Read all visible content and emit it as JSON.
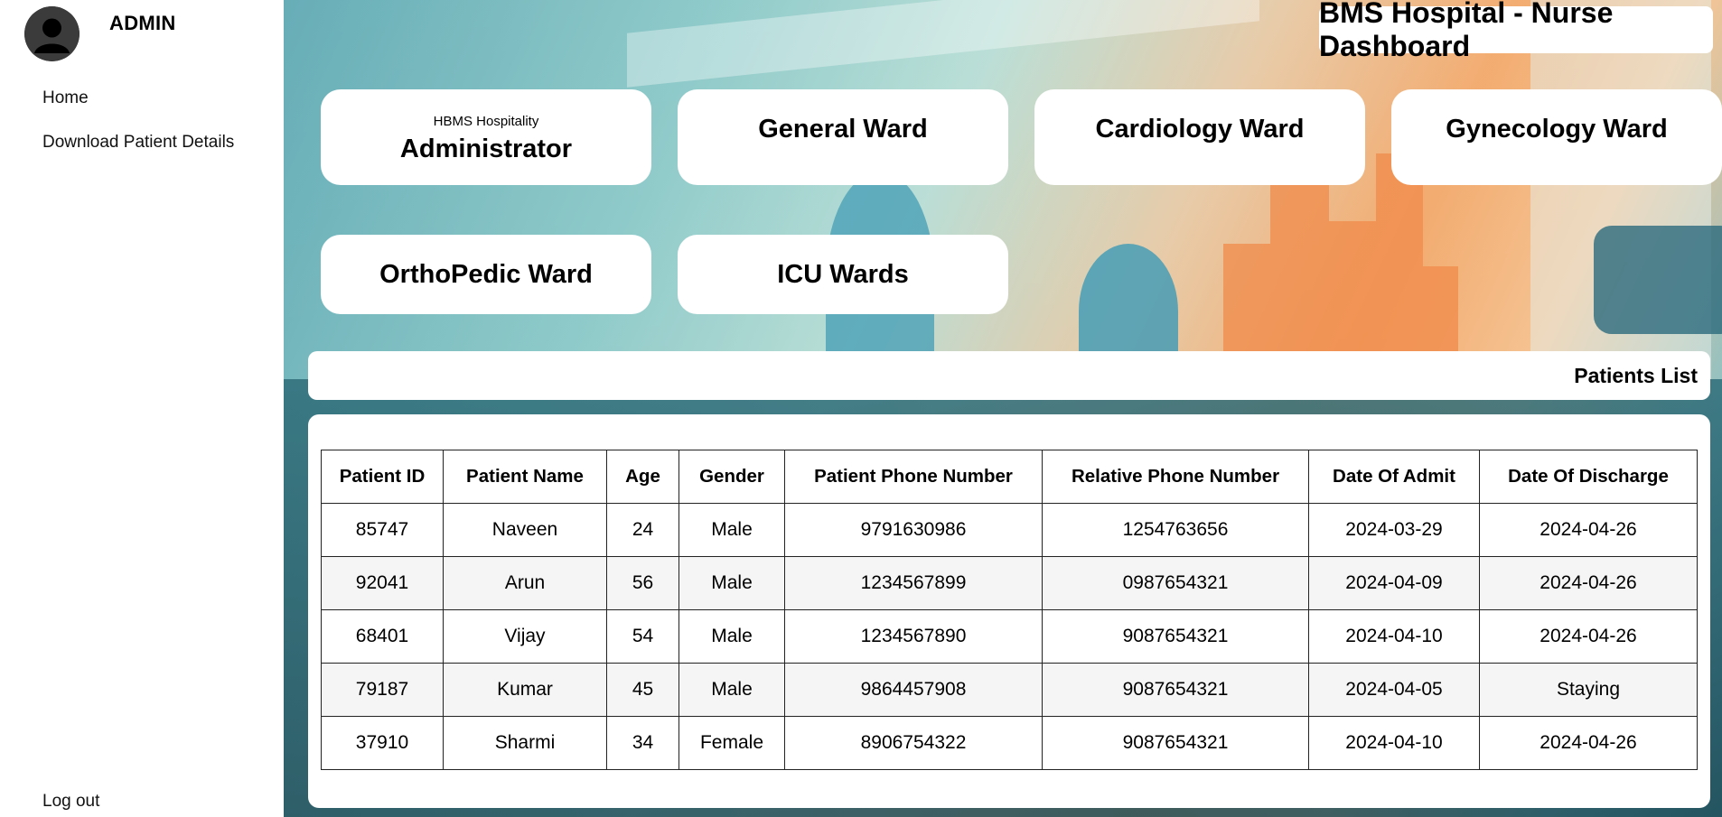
{
  "sidebar": {
    "user_name": "ADMIN",
    "nav": {
      "home": "Home",
      "download": "Download Patient Details",
      "logout": "Log out"
    }
  },
  "header": {
    "title": "BMS Hospital - Nurse Dashboard"
  },
  "cards": {
    "administrator": {
      "sub": "HBMS Hospitality",
      "label": "Administrator"
    },
    "general": "General Ward",
    "cardiology": "Cardiology Ward",
    "gynecology": "Gynecology Ward",
    "orthopedic": "OrthoPedic Ward",
    "icu": "ICU Wards"
  },
  "patients": {
    "section_title": "Patients List",
    "columns": [
      "Patient ID",
      "Patient Name",
      "Age",
      "Gender",
      "Patient Phone Number",
      "Relative Phone Number",
      "Date Of Admit",
      "Date Of Discharge"
    ],
    "rows": [
      [
        "85747",
        "Naveen",
        "24",
        "Male",
        "9791630986",
        "1254763656",
        "2024-03-29",
        "2024-04-26"
      ],
      [
        "92041",
        "Arun",
        "56",
        "Male",
        "1234567899",
        "0987654321",
        "2024-04-09",
        "2024-04-26"
      ],
      [
        "68401",
        "Vijay",
        "54",
        "Male",
        "1234567890",
        "9087654321",
        "2024-04-10",
        "2024-04-26"
      ],
      [
        "79187",
        "Kumar",
        "45",
        "Male",
        "9864457908",
        "9087654321",
        "2024-04-05",
        "Staying"
      ],
      [
        "37910",
        "Sharmi",
        "34",
        "Female",
        "8906754322",
        "9087654321",
        "2024-04-10",
        "2024-04-26"
      ]
    ]
  },
  "icons": {
    "avatar": "user-avatar-icon"
  },
  "colors": {
    "card_background": "#ffffff",
    "avatar": "#3b3b3b"
  }
}
